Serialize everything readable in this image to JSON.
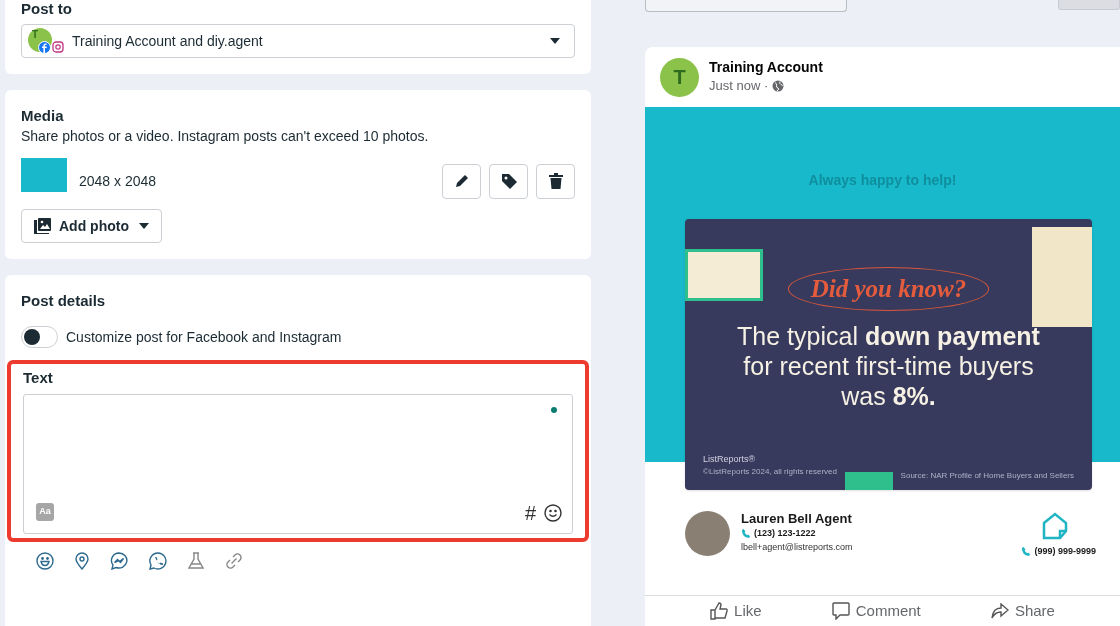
{
  "post_to": {
    "heading": "Post to",
    "account": "Training Account and diy.agent",
    "avatar_letter": "T"
  },
  "media": {
    "heading": "Media",
    "description": "Share photos or a video. Instagram posts can't exceed 10 photos.",
    "file": {
      "dimensions": "2048 x 2048"
    },
    "add_photo": "Add photo"
  },
  "post_details": {
    "heading": "Post details",
    "customize": {
      "label": "Customize post for Facebook and Instagram",
      "on": false
    },
    "text_field": {
      "label": "Text",
      "highlighted": true,
      "format_button": "Aa",
      "hashtag": "#"
    },
    "tools": [
      {
        "kind": "feeling"
      },
      {
        "kind": "location"
      },
      {
        "kind": "messenger"
      },
      {
        "kind": "whatsapp"
      },
      {
        "kind": "lab"
      },
      {
        "kind": "link"
      }
    ]
  },
  "preview": {
    "account": "Training Account",
    "avatar_letter": "T",
    "time": "Just now ·",
    "graphic": {
      "tagline": "Always happy to help!",
      "title": "Did you know?",
      "headline": "The typical **down payment** for recent first-time buyers was **8%.**",
      "brand": "ListReports®",
      "copyright": "©ListReports 2024, all rights reserved",
      "source": "Source: NAR Profile of Home Buyers and Sellers",
      "agent": {
        "name": "Lauren Bell Agent",
        "phone": "(123) 123-1222",
        "email": "lbell+agent@listreports.com",
        "office_phone": "(999) 999-9999"
      }
    },
    "actions": [
      {
        "kind": "like",
        "label": "Like"
      },
      {
        "kind": "comment",
        "label": "Comment"
      },
      {
        "kind": "share",
        "label": "Share"
      }
    ]
  }
}
